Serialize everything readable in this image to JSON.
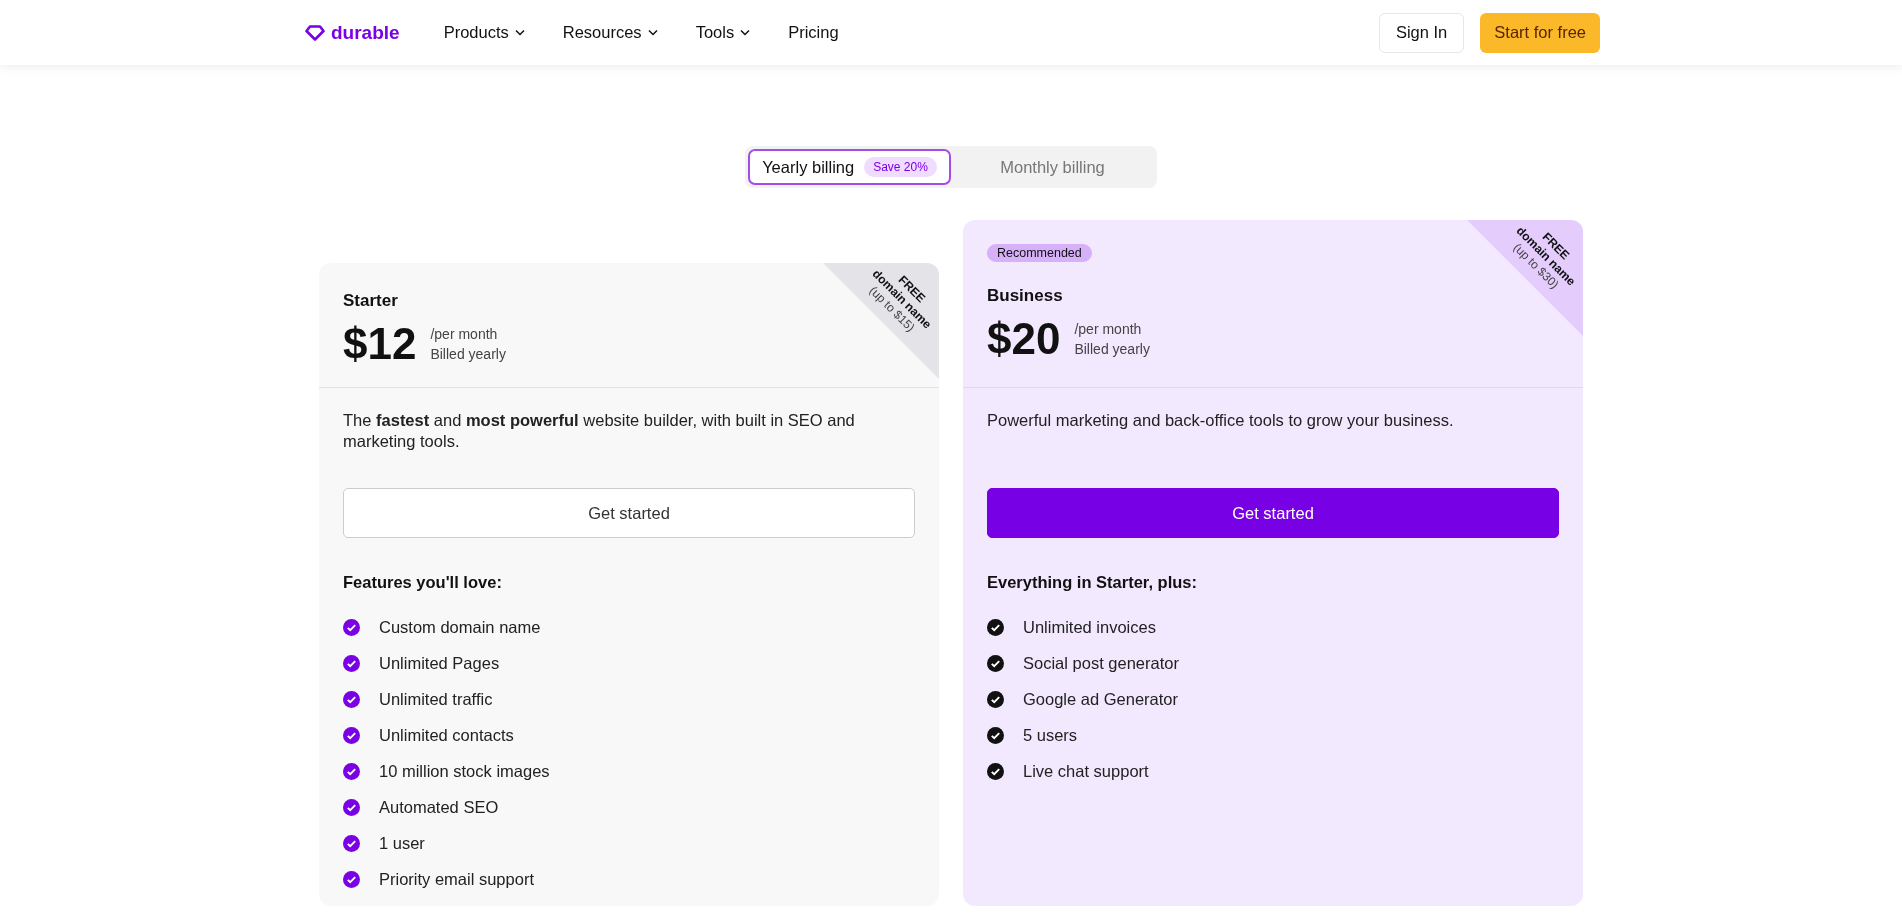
{
  "nav": {
    "logo": "durable",
    "items": [
      {
        "label": "Products",
        "dropdown": true
      },
      {
        "label": "Resources",
        "dropdown": true
      },
      {
        "label": "Tools",
        "dropdown": true
      },
      {
        "label": "Pricing",
        "dropdown": false
      }
    ],
    "sign_in": "Sign In",
    "cta": "Start for free"
  },
  "billing_toggle": {
    "options": [
      {
        "label": "Yearly billing",
        "badge": "Save 20%",
        "selected": true
      },
      {
        "label": "Monthly billing",
        "selected": false
      }
    ]
  },
  "plans": [
    {
      "name": "Starter",
      "highlighted": false,
      "price": "$12",
      "period": "/per month",
      "billing": "Billed yearly",
      "ribbon": {
        "title": "FREE",
        "line": "domain name",
        "note": "(up to $15)"
      },
      "description": "The **fastest** and **most powerful** website builder, with built in SEO and marketing tools.",
      "button": "Get started",
      "features_title": "Features you'll love:",
      "features": [
        "Custom domain name",
        "Unlimited Pages",
        "Unlimited traffic",
        "Unlimited contacts",
        "10 million stock images",
        "Automated SEO",
        "1 user",
        "Priority email support"
      ]
    },
    {
      "name": "Business",
      "badge": "Recommended",
      "highlighted": true,
      "price": "$20",
      "period": "/per month",
      "billing": "Billed yearly",
      "ribbon": {
        "title": "FREE",
        "line": "domain name",
        "note": "(up to $30)"
      },
      "description": "Powerful marketing and back-office tools to grow your business.",
      "button": "Get started",
      "features_title": "Everything in Starter, plus:",
      "features": [
        "Unlimited invoices",
        "Social post generator",
        "Google ad Generator",
        "5 users",
        "Live chat support"
      ]
    }
  ]
}
